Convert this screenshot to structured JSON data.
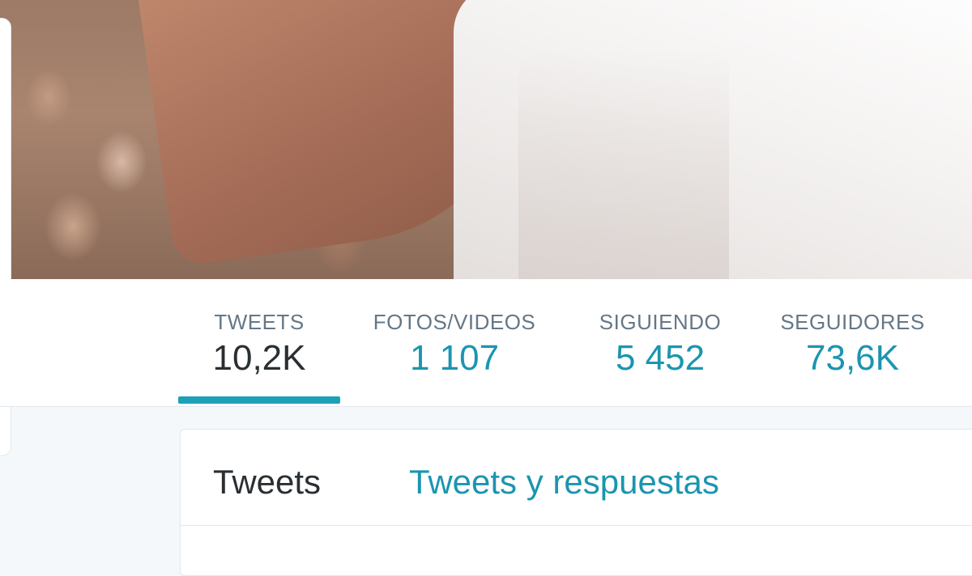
{
  "stats": [
    {
      "label": "TWEETS",
      "value": "10,2K",
      "active": true
    },
    {
      "label": "FOTOS/VIDEOS",
      "value": "1 107",
      "active": false
    },
    {
      "label": "SIGUIENDO",
      "value": "5 452",
      "active": false
    },
    {
      "label": "SEGUIDORES",
      "value": "73,6K",
      "active": false
    }
  ],
  "timeline_tabs": {
    "tweets": "Tweets",
    "tweets_and_replies": "Tweets y respuestas"
  },
  "colors": {
    "accent": "#1b95b0",
    "text_primary": "#292f33",
    "text_secondary": "#657786",
    "border": "#e1e8ed",
    "background": "#f5f8fa"
  }
}
